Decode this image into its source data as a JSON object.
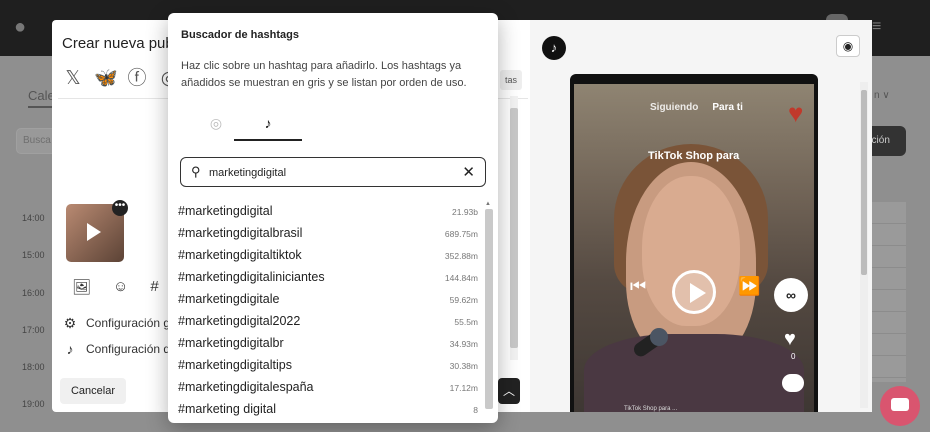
{
  "background": {
    "tab_label": "Cale",
    "search_placeholder": "Busca",
    "times": [
      "14:00",
      "15:00",
      "16:00",
      "17:00",
      "18:00",
      "19:00"
    ],
    "right_view_label": "n ∨",
    "right_button_label": "ación"
  },
  "post_modal": {
    "title": "Crear nueva pub",
    "social_icons": [
      "x-icon",
      "bluesky-icon",
      "facebook-icon",
      "instagram-icon"
    ],
    "tab_stub": "tas",
    "config_general": "Configuración g",
    "config_tiktok": "Configuración d",
    "cancel_label": "Cancelar"
  },
  "preview": {
    "tab_following": "Siguiendo",
    "tab_for_you": "Para ti",
    "shop_text": "TikTok Shop para",
    "like_count": "0",
    "caption": "TikTok Shop para ..."
  },
  "finder": {
    "title": "Buscador de hashtags",
    "description": "Haz clic sobre un hashtag para añadirlo. Los hashtags ya añadidos se muestran en gris y se listan por orden de uso.",
    "search_value": "marketingdigital",
    "hashtags": [
      {
        "tag": "#marketingdigital",
        "count": "21.93b"
      },
      {
        "tag": "#marketingdigitalbrasil",
        "count": "689.75m"
      },
      {
        "tag": "#marketingdigitaltiktok",
        "count": "352.88m"
      },
      {
        "tag": "#marketingdigitaliniciantes",
        "count": "144.84m"
      },
      {
        "tag": "#marketingdigitale",
        "count": "59.62m"
      },
      {
        "tag": "#marketingdigital2022",
        "count": "55.5m"
      },
      {
        "tag": "#marketingdigitalbr",
        "count": "34.93m"
      },
      {
        "tag": "#marketingdigitaltips",
        "count": "30.38m"
      },
      {
        "tag": "#marketingdigitalespaña",
        "count": "17.12m"
      },
      {
        "tag": "#marketing digital",
        "count": "8"
      }
    ]
  }
}
